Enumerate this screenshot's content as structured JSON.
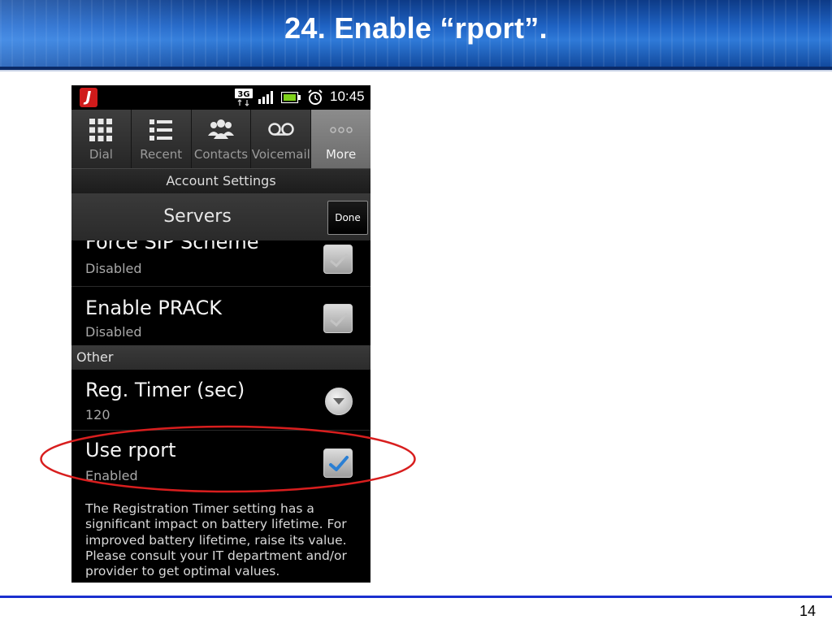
{
  "slide": {
    "title": "24. Enable “rport”.",
    "page_number": "14"
  },
  "phone": {
    "status_bar": {
      "app_icon": "J",
      "network": "3G",
      "icons": [
        "app-icon",
        "3g-icon",
        "signal-icon",
        "battery-icon",
        "alarm-icon"
      ],
      "time": "10:45"
    },
    "tabs": [
      {
        "label": "Dial",
        "icon": "dialpad-icon"
      },
      {
        "label": "Recent",
        "icon": "list-icon"
      },
      {
        "label": "Contacts",
        "icon": "contacts-icon"
      },
      {
        "label": "Voicemail",
        "icon": "voicemail-icon"
      },
      {
        "label": "More",
        "icon": "more-icon",
        "active": true
      }
    ],
    "section_title": "Account Settings",
    "toolbar": {
      "title": "Servers",
      "done_label": "Done"
    },
    "settings": {
      "force_sip": {
        "title": "Force SIP Scheme",
        "value": "Disabled",
        "checked": false
      },
      "enable_prack": {
        "title": "Enable PRACK",
        "value": "Disabled",
        "checked": false
      },
      "group_other": "Other",
      "reg_timer": {
        "title": "Reg. Timer (sec)",
        "value": "120"
      },
      "use_rport": {
        "title": "Use rport",
        "value": "Enabled",
        "checked": true
      }
    },
    "help_text": "The Registration Timer setting has a significant impact on battery lifetime. For improved battery lifetime, raise its value. Please consult your IT department and/or provider to get optimal values."
  },
  "colors": {
    "highlight": "#d81e1e",
    "check": "#2a7fd4",
    "header_blue": "#1f63c4",
    "footer_line": "#1a2fcf"
  }
}
